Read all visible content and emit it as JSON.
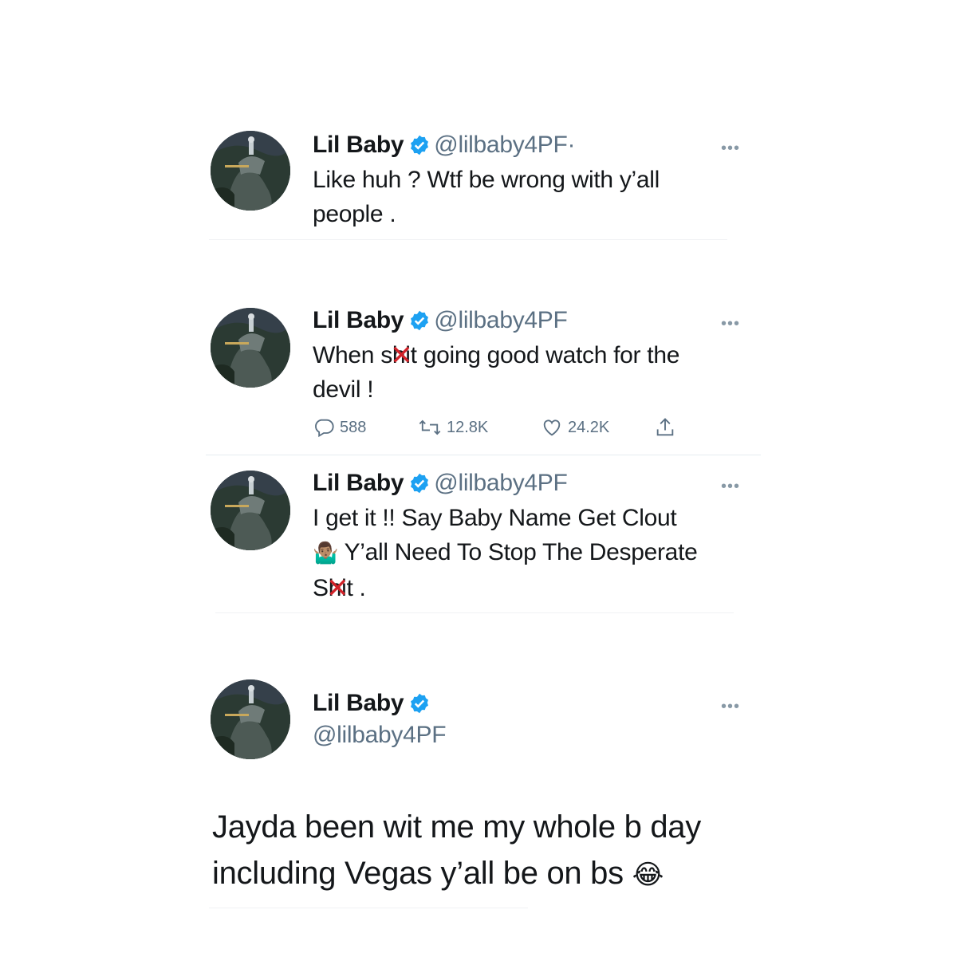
{
  "tweets": [
    {
      "name": "Lil Baby",
      "handle": "@lilbaby4PF",
      "dot": "·",
      "more": "•••",
      "text_line1": "Like huh ? Wtf be wrong with y’all",
      "text_line2": "people ."
    },
    {
      "name": "Lil Baby",
      "handle": "@lilbaby4PF",
      "more": "•••",
      "text_pre": "When s",
      "text_censored": "hi",
      "text_post": "t going good watch for the",
      "text_line2": "devil !",
      "reply_count": "588",
      "retweet_count": "12.8K",
      "like_count": "24.2K"
    },
    {
      "name": "Lil Baby",
      "handle": "@lilbaby4PF",
      "more": "•••",
      "text_line1": "I get it !! Say Baby Name Get Clout",
      "emoji": "🤷🏽‍♂️",
      "text_line2": "Y’all Need To Stop The Desperate",
      "text_pre3": "S",
      "text_censored3": "hi",
      "text_post3": "t ."
    },
    {
      "name": "Lil Baby",
      "handle": "@lilbaby4PF",
      "more": "•••",
      "text_line1": "Jayda been wit me my whole b day",
      "text_line2": "including Vegas y’all be on bs",
      "emoji": "😂"
    }
  ],
  "icons": {
    "verified": "verified-badge-icon",
    "reply": "reply-icon",
    "retweet": "retweet-icon",
    "like": "like-icon",
    "share": "share-icon",
    "censor": "red-x-icon"
  },
  "colors": {
    "verified": "#1da1f2",
    "secondary_text": "#5b7083",
    "censor_x": "#d2232a"
  }
}
